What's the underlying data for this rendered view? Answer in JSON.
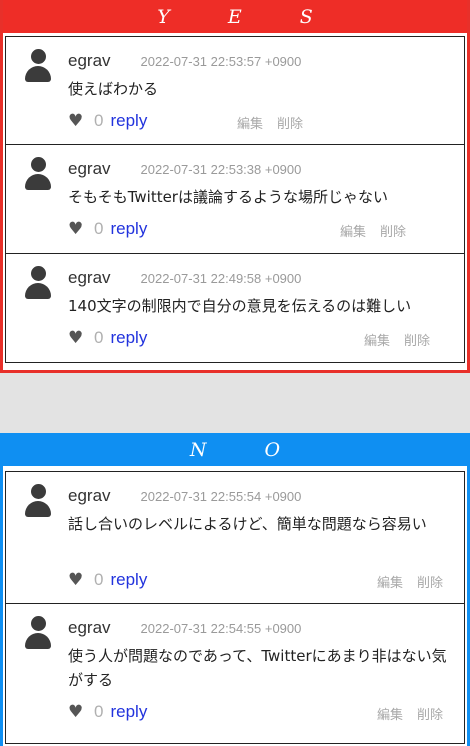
{
  "yes": {
    "header": "Y E S",
    "comments": [
      {
        "user": "egrav",
        "date": "2022-07-31 22:53:57 +0900",
        "text": "使えばわかる",
        "likes": "0",
        "reply": "reply",
        "edit": "編集",
        "delete": "削除"
      },
      {
        "user": "egrav",
        "date": "2022-07-31 22:53:38 +0900",
        "text": "そもそもTwitterは議論するような場所じゃない",
        "likes": "0",
        "reply": "reply",
        "edit": "編集",
        "delete": "削除"
      },
      {
        "user": "egrav",
        "date": "2022-07-31 22:49:58 +0900",
        "text": "140文字の制限内で自分の意見を伝えるのは難しい",
        "likes": "0",
        "reply": "reply",
        "edit": "編集",
        "delete": "削除"
      }
    ]
  },
  "no": {
    "header": "N O",
    "comments": [
      {
        "user": "egrav",
        "date": "2022-07-31 22:55:54 +0900",
        "text": "話し合いのレベルによるけど、簡単な問題なら容易い",
        "likes": "0",
        "reply": "reply",
        "edit": "編集",
        "delete": "削除"
      },
      {
        "user": "egrav",
        "date": "2022-07-31 22:54:55 +0900",
        "text": "使う人が問題なのであって、Twitterにあまり非はない気がする",
        "likes": "0",
        "reply": "reply",
        "edit": "編集",
        "delete": "削除"
      }
    ]
  },
  "colors": {
    "yes": "#ee2d27",
    "no": "#0f8ff2",
    "link": "#2233dd"
  },
  "icons": {
    "avatar": "user-avatar-icon",
    "like": "heart-icon"
  }
}
